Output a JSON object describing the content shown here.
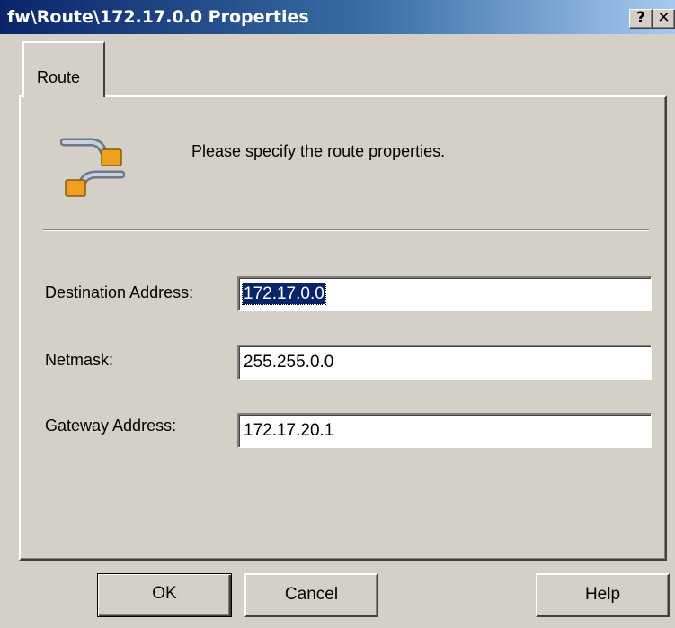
{
  "window": {
    "title": "fw\\Route\\172.17.0.0 Properties",
    "help_glyph": "?",
    "close_glyph": "✕"
  },
  "tabs": [
    {
      "label": "Route",
      "selected": true
    }
  ],
  "panel": {
    "icon": "route-icon",
    "instructions": "Please specify the route properties.",
    "fields": {
      "destination": {
        "label": "Destination Address:",
        "value": "172.17.0.0",
        "selected": true
      },
      "netmask": {
        "label": "Netmask:",
        "value": "255.255.0.0"
      },
      "gateway": {
        "label": "Gateway Address:",
        "value": "172.17.20.1"
      }
    }
  },
  "buttons": {
    "ok": "OK",
    "cancel": "Cancel",
    "help": "Help"
  },
  "colors": {
    "title_bar_start": "#0a246a",
    "title_bar_end": "#a6caf0",
    "face": "#d4d0c8",
    "selection": "#0a246a",
    "icon_accent": "#f0a020"
  }
}
